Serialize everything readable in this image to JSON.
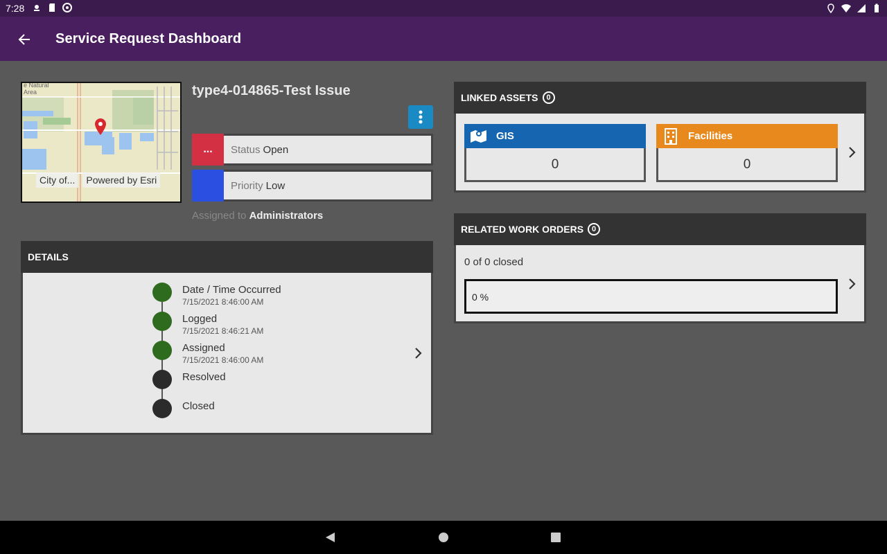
{
  "status_bar": {
    "time": "7:28",
    "icons_left": [
      "notification-icon",
      "sd-card-icon",
      "sync-icon"
    ],
    "icons_right": [
      "location-icon",
      "wifi-icon",
      "signal-icon",
      "battery-icon"
    ]
  },
  "app_bar": {
    "title": "Service Request Dashboard",
    "back_icon": "arrow-left-icon"
  },
  "map": {
    "attribution_left": "City of...",
    "attribution_right": "Powered by Esri",
    "corner_label": "e Natural\nArea"
  },
  "issue": {
    "title": "type4-014865-Test Issue",
    "status_label": "Status",
    "status_value": "Open",
    "status_swatch_text": "...",
    "status_color": "#d43044",
    "priority_label": "Priority",
    "priority_value": "Low",
    "priority_color": "#2b4fe0",
    "assigned_label": "Assigned to",
    "assigned_value": "Administrators"
  },
  "details": {
    "header": "DETAILS",
    "timeline": [
      {
        "title": "Date / Time Occurred",
        "date": "7/15/2021 8:46:00 AM",
        "state": "done"
      },
      {
        "title": "Logged",
        "date": "7/15/2021 8:46:21 AM",
        "state": "done"
      },
      {
        "title": "Assigned",
        "date": "7/15/2021 8:46:00 AM",
        "state": "done"
      },
      {
        "title": "Resolved",
        "date": "",
        "state": "pending"
      },
      {
        "title": "Closed",
        "date": "",
        "state": "pending"
      }
    ],
    "done_color": "#2e6b1e",
    "pending_color": "#2b2b2b"
  },
  "linked_assets": {
    "header": "LINKED ASSETS",
    "count": "0",
    "cards": [
      {
        "label": "GIS",
        "count": "0",
        "color": "#1565b0",
        "icon": "map-icon"
      },
      {
        "label": "Facilities",
        "count": "0",
        "color": "#e8891e",
        "icon": "building-icon"
      }
    ]
  },
  "related_work_orders": {
    "header": "RELATED WORK ORDERS",
    "count": "0",
    "closed_text": "0 of 0 closed",
    "progress_text": "0 %",
    "progress_fraction": 0
  }
}
